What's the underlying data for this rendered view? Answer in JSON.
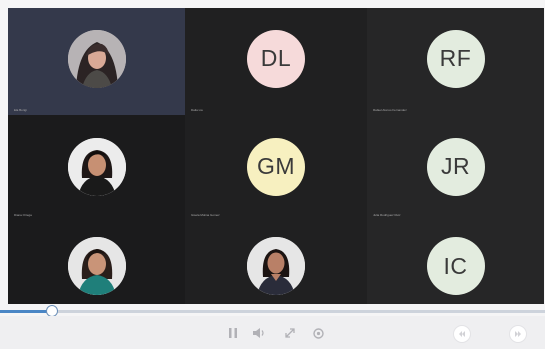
{
  "participants": [
    {
      "kind": "photo",
      "name": "Ela Borigi",
      "bg": "#34394b",
      "photo": "woman-dark-hair"
    },
    {
      "kind": "initials",
      "initials": "DL",
      "name": "Dalia Lia",
      "bg": "#f6dada",
      "fg": "#3a3a3a"
    },
    {
      "kind": "initials",
      "initials": "RF",
      "name": "Rafael Alonso Fernandez",
      "bg": "#e3ecdf",
      "fg": "#3a3a3a"
    },
    {
      "kind": "photo",
      "name": "Diana Ortega",
      "bg": "#e9e9e9",
      "photo": "woman-dark-hair-light-top"
    },
    {
      "kind": "initials",
      "initials": "GM",
      "name": "Gisela Molina Gomez",
      "bg": "#f7f0c0",
      "fg": "#3a3a3a"
    },
    {
      "kind": "initials",
      "initials": "JR",
      "name": "Julia Rodriguez Ruiz",
      "bg": "#e3ecdf",
      "fg": "#3a3a3a"
    },
    {
      "kind": "photo",
      "name": "",
      "bg": "#e6e6e6",
      "photo": "woman-teal-top"
    },
    {
      "kind": "photo",
      "name": "",
      "bg": "#e6e6e6",
      "photo": "woman-dark-top"
    },
    {
      "kind": "initials",
      "initials": "IC",
      "name": "",
      "bg": "#e3ecdf",
      "fg": "#3a3a3a"
    }
  ],
  "player": {
    "progress": 0.096,
    "icons": {
      "pause": "pause-icon",
      "volume": "volume-icon",
      "fullscreen": "expand-icon",
      "settings": "gear-icon",
      "rewind": "rewind-icon",
      "forward": "forward-icon"
    }
  }
}
